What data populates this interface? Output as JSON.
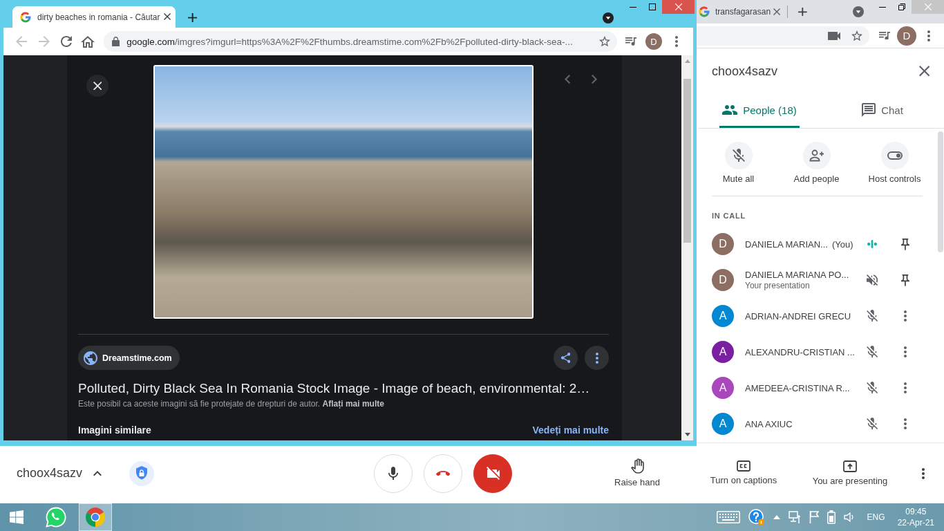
{
  "front_window": {
    "tab": {
      "title": "dirty beaches in romania - Căutar"
    },
    "back": {
      "disabled": true
    },
    "forward": {
      "disabled": true
    },
    "url": {
      "host": "google.com",
      "path": "/imgres?imgurl=https%3A%2F%2Fthumbs.dreamstime.com%2Fb%2Fpolluted-dirty-black-sea-..."
    },
    "profile": "D",
    "viewer": {
      "source": "Dreamstime.com",
      "title": "Polluted, Dirty Black Sea In Romania Stock Image - Image of beach, environmental: 2…",
      "notice": {
        "text": "Este posibil ca aceste imagini să fie protejate de drepturi de autor.",
        "link": "Aflați mai multe"
      },
      "similar": {
        "heading": "Imagini similare",
        "link": "Vedeți mai multe"
      }
    }
  },
  "back_window": {
    "tab": {
      "title": "transfagarasan"
    },
    "profile": "D",
    "meeting": {
      "title": "choox4sazv",
      "tabs": [
        {
          "kind": "people",
          "label": "People (18)",
          "selected": true
        },
        {
          "kind": "chat",
          "label": "Chat",
          "selected": false
        }
      ],
      "actions": [
        {
          "kind": "mute-all",
          "label": "Mute all"
        },
        {
          "kind": "add-people",
          "label": "Add people"
        },
        {
          "kind": "host-controls",
          "label": "Host controls"
        }
      ],
      "section": "IN CALL",
      "participants": [
        {
          "initial": "D",
          "color": "#8d6e63",
          "name": "DANIELA MARIAN...",
          "tag": "(You)",
          "kind": "self",
          "muted": false
        },
        {
          "initial": "D",
          "color": "#8d6e63",
          "name": "DANIELA MARIANA PO...",
          "note": "Your presentation",
          "kind": "presentation",
          "muted": true
        },
        {
          "initial": "A",
          "color": "#0288d1",
          "name": "ADRIAN-ANDREI GRECU",
          "kind": "guest",
          "muted": true
        },
        {
          "initial": "A",
          "color": "#7b1fa2",
          "name": "ALEXANDRU-CRISTIAN ...",
          "kind": "guest",
          "muted": true
        },
        {
          "initial": "A",
          "color": "#ab47bc",
          "name": "AMEDEEA-CRISTINA R...",
          "kind": "guest",
          "muted": true
        },
        {
          "initial": "A",
          "color": "#0288d1",
          "name": "ANA AXIUC",
          "kind": "guest",
          "muted": true
        }
      ]
    },
    "call_bar": {
      "meeting_code": "choox4sazv",
      "controls": [
        {
          "kind": "mic",
          "on": true
        },
        {
          "kind": "hang-up"
        },
        {
          "kind": "camera",
          "on": false
        }
      ],
      "actions": [
        {
          "kind": "raise-hand",
          "label": "Raise hand"
        },
        {
          "kind": "captions",
          "label": "Turn on captions"
        },
        {
          "kind": "present",
          "label": "You are presenting"
        }
      ]
    }
  },
  "taskbar": {
    "apps": [
      {
        "kind": "messenger",
        "selected": false
      },
      {
        "kind": "browser",
        "selected": true
      }
    ],
    "language": "ENG",
    "time": "09:45",
    "date": "22-Apr-21"
  }
}
